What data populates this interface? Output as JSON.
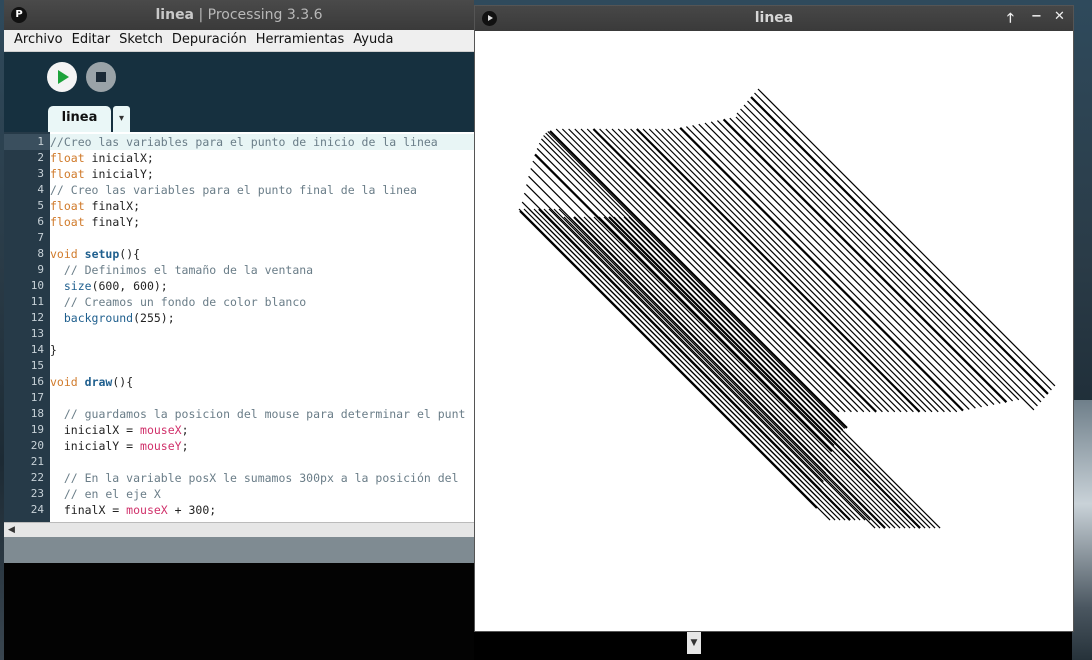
{
  "ide": {
    "title_name": "linea",
    "title_sep": " | ",
    "title_app": "Processing 3.3.6",
    "menu": [
      "Archivo",
      "Editar",
      "Sketch",
      "Depuración",
      "Herramientas",
      "Ayuda"
    ],
    "tab_label": "linea",
    "tab_menu_icon": "▾",
    "line_numbers": [
      "1",
      "2",
      "3",
      "4",
      "5",
      "6",
      "7",
      "8",
      "9",
      "10",
      "11",
      "12",
      "13",
      "14",
      "15",
      "16",
      "17",
      "18",
      "19",
      "20",
      "21",
      "22",
      "23",
      "24"
    ]
  },
  "code": {
    "l1": "//Creo las variables para el punto de inicio de la linea",
    "l2_kw": "float",
    "l2_rest": " inicialX;",
    "l3_kw": "float",
    "l3_rest": " inicialY;",
    "l4": "// Creo las variables para el punto final de la linea",
    "l5_kw": "float",
    "l5_rest": " finalX;",
    "l6_kw": "float",
    "l6_rest": " finalY;",
    "l8_kw": "void",
    "l8_fn": "setup",
    "l8_rest": "(){",
    "l9": "  // Definimos el tamaño de la ventana",
    "l10_fn": "size",
    "l10_rest": "(600, 600);",
    "l11": "  // Creamos un fondo de color blanco",
    "l12_fn": "background",
    "l12_rest": "(255);",
    "l14": "}",
    "l16_kw": "void",
    "l16_fn": "draw",
    "l16_rest": "(){",
    "l18": "  // guardamos la posicion del mouse para determinar el punt",
    "l19_a": "  inicialX = ",
    "l19_var": "mouseX",
    "l19_b": ";",
    "l20_a": "  inicialY = ",
    "l20_var": "mouseY",
    "l20_b": ";",
    "l22": "  // En la variable posX le sumamos 300px a la posición del",
    "l23": "  // en el eje X",
    "l24_a": "  finalX = ",
    "l24_var": "mouseX",
    "l24_b": " + 300;"
  },
  "sketch": {
    "title": "linea",
    "btn_max": "🡑",
    "btn_min": "−",
    "btn_close": "✕"
  },
  "colors": {
    "keyword": "#d07a2a",
    "function": "#1f5f8e",
    "builtin_var": "#d0306a",
    "comment": "#6a7d88"
  }
}
